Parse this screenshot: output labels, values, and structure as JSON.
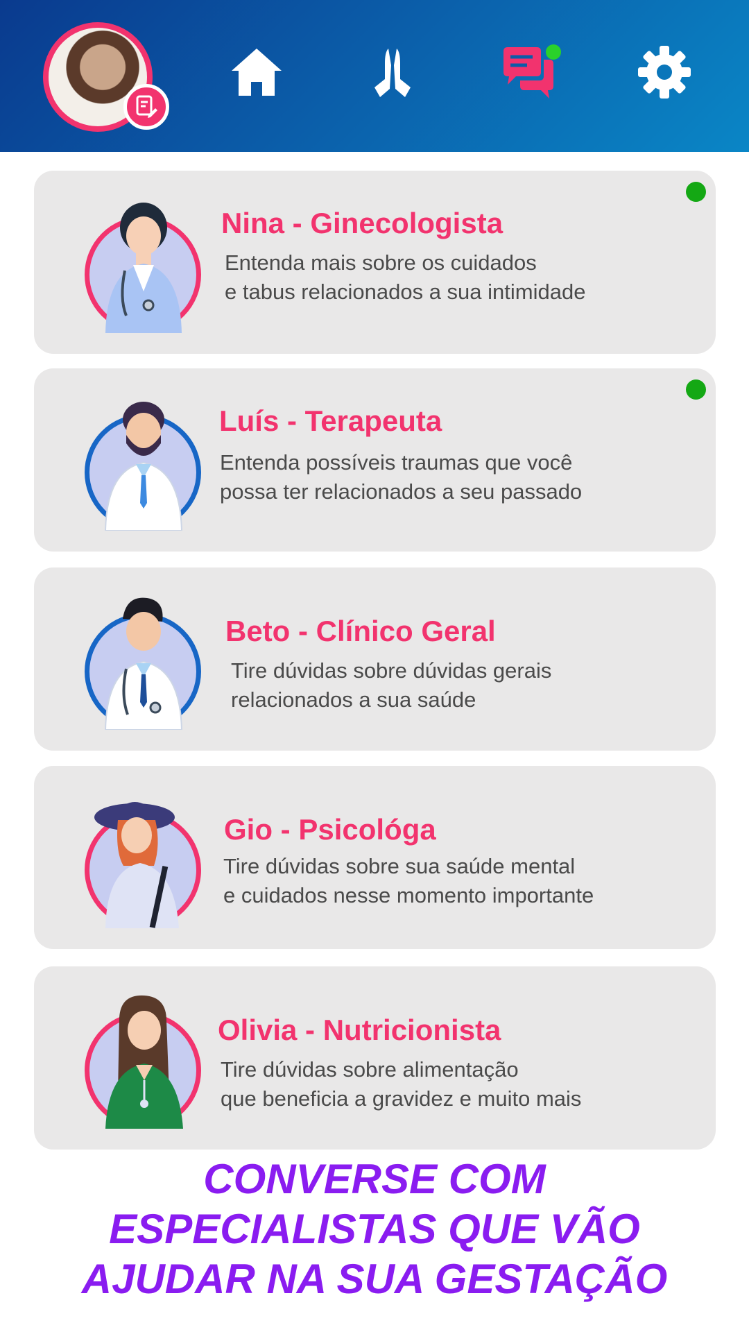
{
  "header": {
    "nav": [
      {
        "id": "home",
        "icon": "home-icon"
      },
      {
        "id": "prayer",
        "icon": "praying-hands-icon"
      },
      {
        "id": "chat",
        "icon": "chat-bubbles-icon",
        "notification": true
      },
      {
        "id": "settings",
        "icon": "gear-icon"
      }
    ],
    "accent_color": "#f2336e",
    "notification_color": "#2ad12a"
  },
  "specialists": [
    {
      "name": "Nina - Ginecologista",
      "line1": "Entenda mais sobre os cuidados",
      "line2": "e tabus relacionados a sua intimidade",
      "online": true
    },
    {
      "name": "Luís - Terapeuta",
      "line1": "Entenda possíveis traumas que você",
      "line2": "possa ter relacionados a seu passado",
      "online": true
    },
    {
      "name": "Beto - Clínico Geral",
      "line1": "Tire dúvidas sobre dúvidas gerais",
      "line2": "relacionados a sua saúde",
      "online": false
    },
    {
      "name": "Gio - Psicológa",
      "line1": "Tire dúvidas sobre sua saúde mental",
      "line2": "e cuidados nesse momento importante",
      "online": false
    },
    {
      "name": "Olivia - Nutricionista",
      "line1": "Tire dúvidas sobre alimentação",
      "line2": "que beneficia a gravidez e muito mais",
      "online": false
    }
  ],
  "cta": {
    "line1": "CONVERSE COM",
    "line2": "ESPECIALISTAS QUE VÃO",
    "line3": "AJUDAR NA SUA GESTAÇÃO",
    "color": "#8a1cf0"
  }
}
